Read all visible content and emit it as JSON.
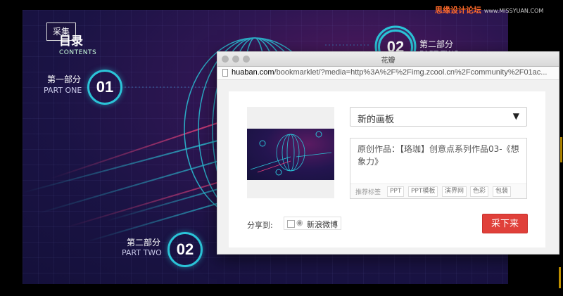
{
  "slide": {
    "collect_badge": "采集",
    "toc_title": "目录",
    "toc_subtitle": "CONTENTS",
    "parts": [
      {
        "cn": "第一部分",
        "en": "PART ONE",
        "num": "01"
      },
      {
        "cn": "第二部分",
        "en": "PART TWO",
        "num": "02"
      },
      {
        "cn": "第二部分",
        "en": "PART TWO",
        "num": "02"
      }
    ]
  },
  "watermark": {
    "cn": "思缘设计论坛",
    "en": "www.MISSYUAN.COM"
  },
  "dialog": {
    "window_title": "花瓣",
    "url_domain": "huaban.com",
    "url_path": "/bookmarklet/?media=http%3A%2F%2Fimg.zcool.cn%2Fcommunity%2F01ac...",
    "board_select": {
      "value": "新的画板"
    },
    "description": "原创作品：【珞珈】创意点系列作品03-《想象力》",
    "tag_label": "推荐标签",
    "tags": [
      "PPT",
      "PPT模板",
      "演界网",
      "色彩",
      "包装"
    ],
    "share_label": "分享到:",
    "share_weibo": "新浪微博",
    "collect_button": "采下来"
  },
  "colors": {
    "accent_red": "#e0403a",
    "ring_cyan": "#2bc4d8",
    "watermark_orange": "#ff6a2a"
  }
}
